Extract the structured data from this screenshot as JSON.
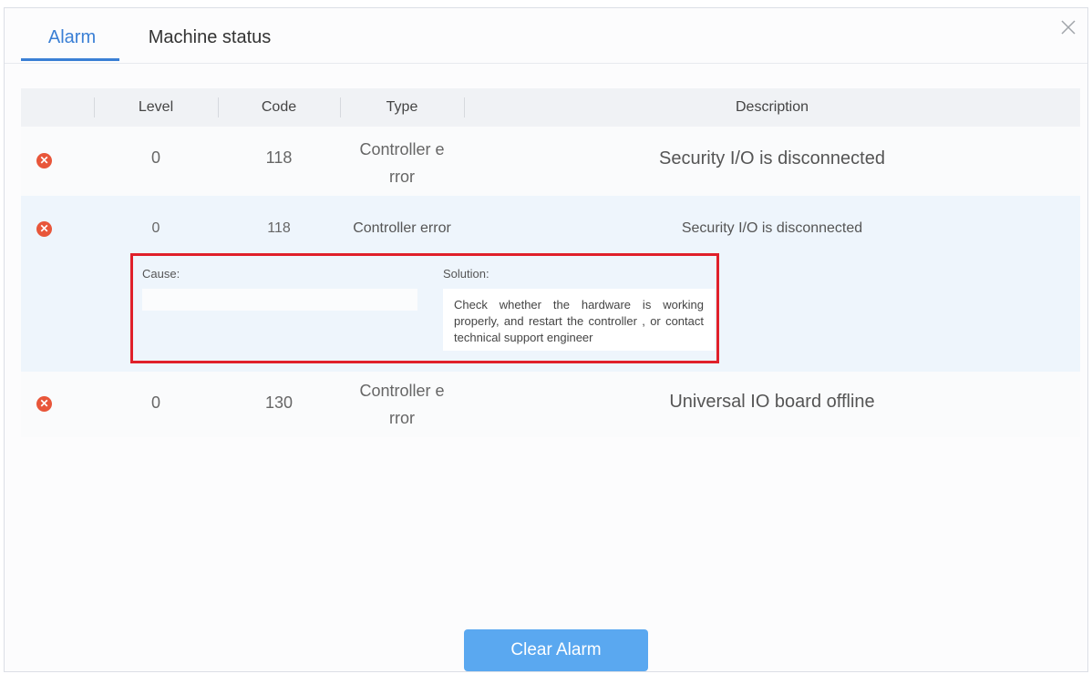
{
  "tabs": [
    {
      "label": "Alarm",
      "active": true
    },
    {
      "label": "Machine status",
      "active": false
    }
  ],
  "close_icon": "close-icon",
  "table": {
    "headers": [
      "Level",
      "Code",
      "Type",
      "Description"
    ],
    "rows": [
      {
        "icon": "error-circle-icon",
        "level": "0",
        "code": "118",
        "type_line1": "Controller e",
        "type_line2": "rror",
        "description": "Security I/O is disconnected"
      },
      {
        "icon": "error-circle-icon",
        "level": "0",
        "code": "118",
        "type": "Controller error",
        "description": "Security I/O is disconnected",
        "detail": {
          "cause_label": "Cause:",
          "cause_value": "",
          "solution_label": "Solution:",
          "solution_value": "Check whether the hardware is working properly, and restart the controller ,  or contact technical support engineer"
        }
      },
      {
        "icon": "error-circle-icon",
        "level": "0",
        "code": "130",
        "type_line1": "Controller e",
        "type_line2": "rror",
        "description": "Universal IO board offline"
      }
    ]
  },
  "clear_button_label": "Clear Alarm",
  "colors": {
    "accent": "#3a7fd5",
    "error": "#e8563a",
    "highlight_border": "#e0202a",
    "button": "#5aa8f0"
  }
}
